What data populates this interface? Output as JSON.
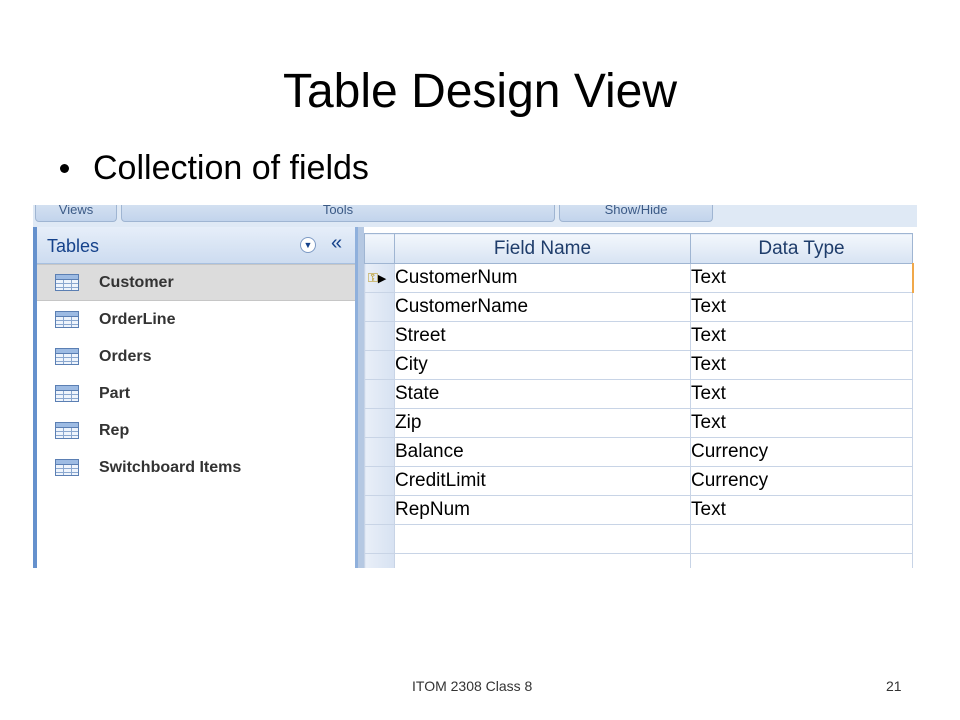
{
  "slide": {
    "title": "Table Design View",
    "bullet": "Collection of fields",
    "footer_center": "ITOM 2308 Class 8",
    "page_number": "21"
  },
  "ribbon": {
    "groups": [
      "Views",
      "Tools",
      "Show/Hide"
    ]
  },
  "nav": {
    "title": "Tables",
    "dropdown_icon": "chevron-down-circle-icon",
    "collapse_icon": "double-chevron-left-icon",
    "items": [
      {
        "label": "Customer",
        "icon": "table-icon",
        "selected": true
      },
      {
        "label": "OrderLine",
        "icon": "table-icon"
      },
      {
        "label": "Orders",
        "icon": "table-icon"
      },
      {
        "label": "Part",
        "icon": "table-icon"
      },
      {
        "label": "Rep",
        "icon": "table-icon"
      },
      {
        "label": "Switchboard Items",
        "icon": "table-icon"
      }
    ]
  },
  "grid": {
    "headers": {
      "field_name": "Field Name",
      "data_type": "Data Type"
    },
    "rows": [
      {
        "field": "CustomerNum",
        "type": "Text",
        "primary_key": true
      },
      {
        "field": "CustomerName",
        "type": "Text"
      },
      {
        "field": "Street",
        "type": "Text"
      },
      {
        "field": "City",
        "type": "Text"
      },
      {
        "field": "State",
        "type": "Text"
      },
      {
        "field": "Zip",
        "type": "Text"
      },
      {
        "field": "Balance",
        "type": "Currency"
      },
      {
        "field": "CreditLimit",
        "type": "Currency"
      },
      {
        "field": "RepNum",
        "type": "Text"
      },
      {
        "field": "",
        "type": ""
      },
      {
        "field": "",
        "type": ""
      }
    ],
    "key_marker": "⚿",
    "current_row_marker": "▶"
  }
}
